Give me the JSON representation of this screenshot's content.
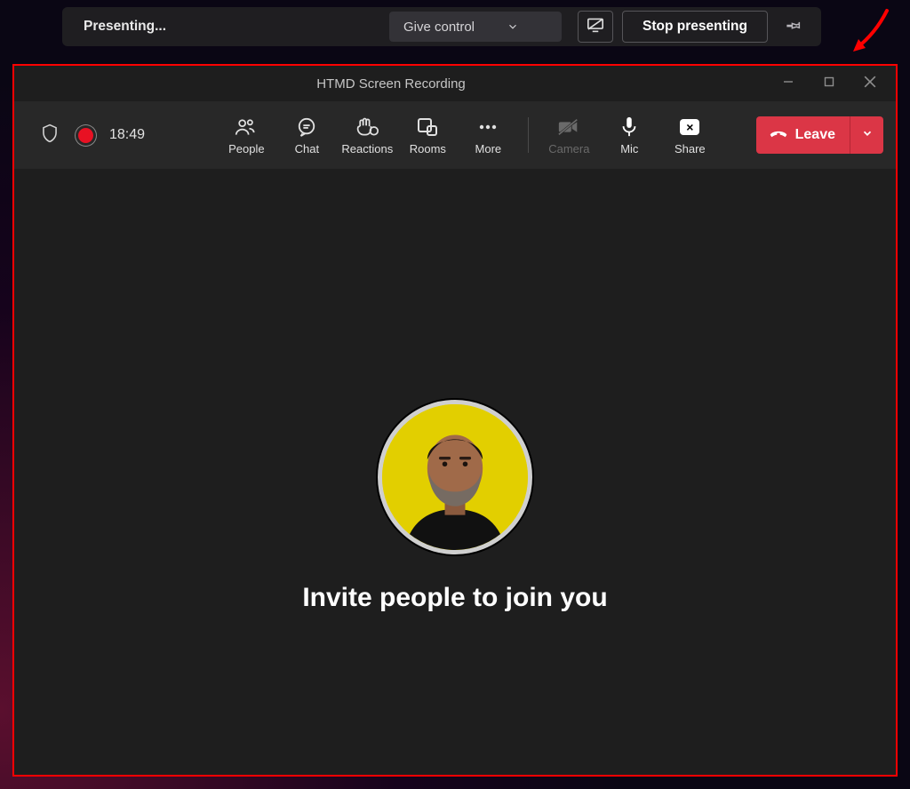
{
  "presenting": {
    "status": "Presenting...",
    "give_control": "Give control",
    "stop_presenting": "Stop presenting"
  },
  "window": {
    "title": "HTMD Screen Recording"
  },
  "toolbar": {
    "elapsed": "18:49",
    "people": "People",
    "chat": "Chat",
    "reactions": "Reactions",
    "rooms": "Rooms",
    "more": "More",
    "camera": "Camera",
    "mic": "Mic",
    "share": "Share",
    "leave": "Leave"
  },
  "main": {
    "invite": "Invite people to join you"
  }
}
